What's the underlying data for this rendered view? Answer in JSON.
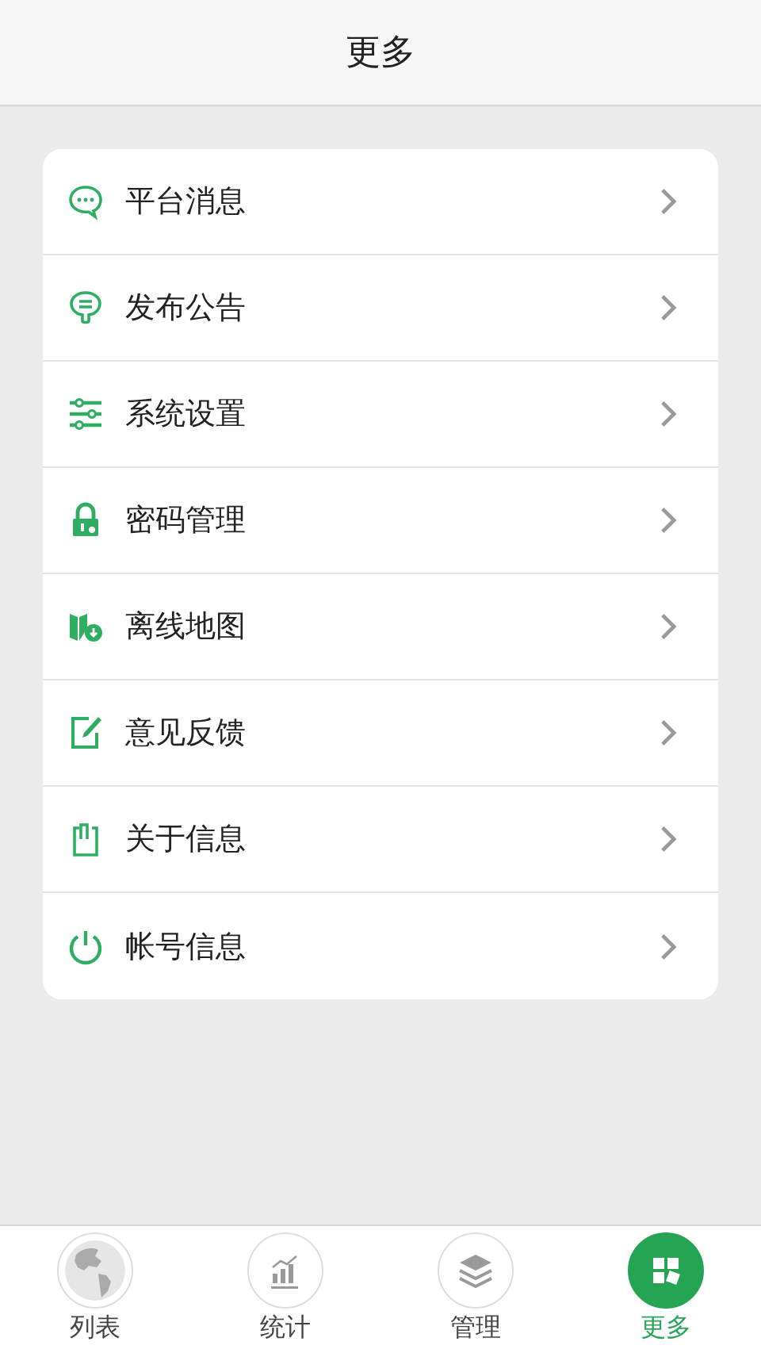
{
  "header": {
    "title": "更多"
  },
  "menu": [
    {
      "label": "平台消息"
    },
    {
      "label": "发布公告"
    },
    {
      "label": "系统设置"
    },
    {
      "label": "密码管理"
    },
    {
      "label": "离线地图"
    },
    {
      "label": "意见反馈"
    },
    {
      "label": "关于信息"
    },
    {
      "label": "帐号信息"
    }
  ],
  "tabs": [
    {
      "label": "列表",
      "selected": false
    },
    {
      "label": "统计",
      "selected": false
    },
    {
      "label": "管理",
      "selected": false
    },
    {
      "label": "更多",
      "selected": true
    }
  ]
}
